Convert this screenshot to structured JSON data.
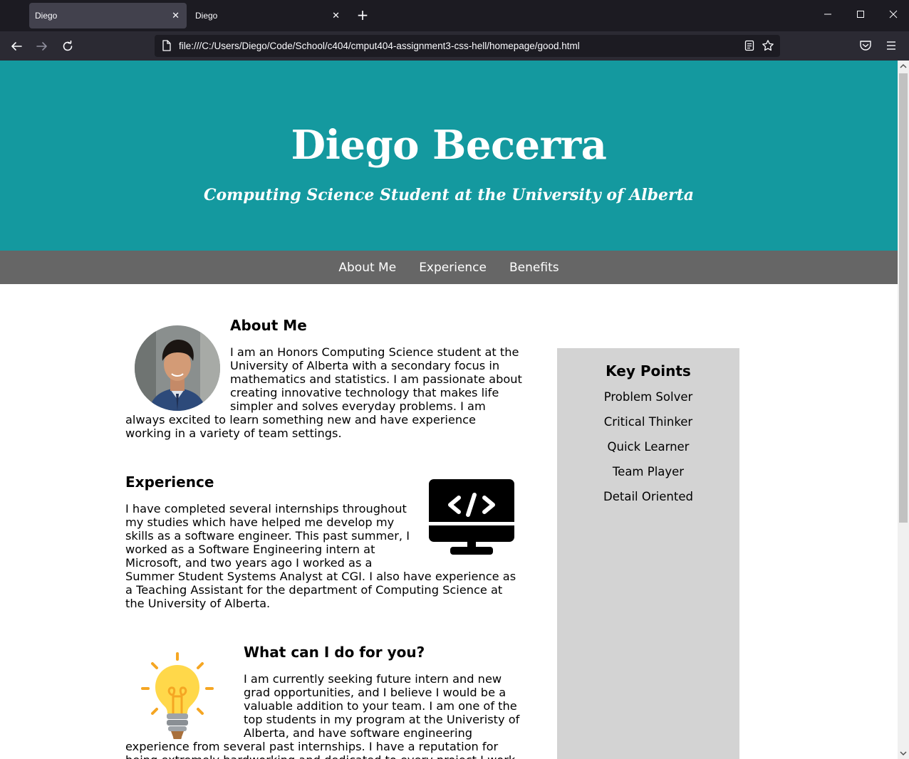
{
  "browser": {
    "tabs": [
      {
        "title": "Diego",
        "active": true
      },
      {
        "title": "Diego",
        "active": false
      }
    ],
    "url": "file:///C:/Users/Diego/Code/School/c404/cmput404-assignment3-css-hell/homepage/good.html"
  },
  "hero": {
    "name": "Diego Becerra",
    "tagline": "Computing Science Student at the University of Alberta"
  },
  "nav": {
    "links": [
      "About Me",
      "Experience",
      "Benefits"
    ]
  },
  "about": {
    "heading": "About Me",
    "text": "I am an Honors Computing Science student at the University of Alberta with a secondary focus in mathematics and statistics. I am passionate about creating innovative technology that makes life simpler and solves everyday problems. I am always excited to learn something new and have experience working in a variety of team settings."
  },
  "experience": {
    "heading": "Experience",
    "text": "I have completed several internships throughout my studies which have helped me develop my skills as a software engineer. This past summer, I worked as a Software Engineering intern at Microsoft, and two years ago I worked as a Summer Student Systems Analyst at CGI. I also have experience as a Teaching Assistant for the department of Computing Science at the University of Alberta."
  },
  "benefits": {
    "heading": "What can I do for you?",
    "text": "I am currently seeking future intern and new grad opportunities, and I believe I would be a valuable addition to your team. I am one of the top students in my program at the Univeristy of Alberta, and have software engineering experience from several past internships. I have a reputation for being extremely hardworking and dedicated to every project I work on."
  },
  "sidebar": {
    "title": "Key Points",
    "points": [
      "Problem Solver",
      "Critical Thinker",
      "Quick Learner",
      "Team Player",
      "Detail Oriented"
    ]
  },
  "colors": {
    "hero_bg": "#14999f",
    "nav_bg": "#666666",
    "sidebar_bg": "#d3d3d3"
  }
}
